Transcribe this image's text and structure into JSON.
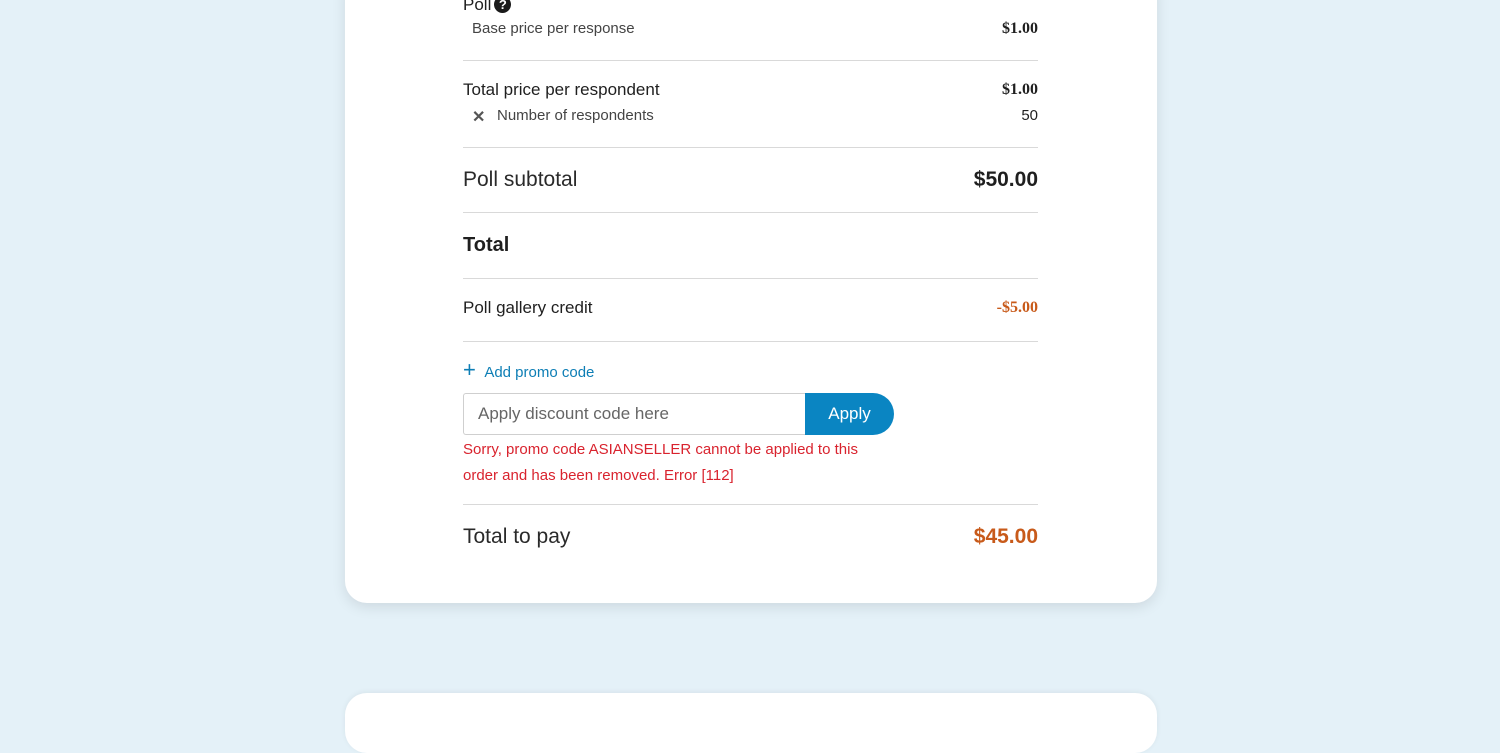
{
  "poll": {
    "title": "Poll",
    "help_icon": "?",
    "base_price_label": "Base price per response",
    "base_price_value": "$1.00"
  },
  "respondent": {
    "total_price_label": "Total price per respondent",
    "total_price_value": "$1.00",
    "multiply_icon": "✕",
    "count_label": "Number of respondents",
    "count_value": "50"
  },
  "subtotal": {
    "label": "Poll subtotal",
    "value": "$50.00"
  },
  "total": {
    "heading": "Total",
    "credit_label": "Poll gallery credit",
    "credit_value": "-$5.00"
  },
  "promo": {
    "add_icon": "+",
    "add_label": "Add promo code",
    "input_placeholder": "Apply discount code here",
    "input_value": "",
    "apply_label": "Apply",
    "error_text": "Sorry, promo code ASIANSELLER cannot be applied to this order and has been removed. Error [112]"
  },
  "pay": {
    "label": "Total to pay",
    "value": "$45.00"
  },
  "colors": {
    "background": "#e4f1f8",
    "accent": "#0a85c2",
    "link": "#0d7eb5",
    "price_highlight": "#c85a1a",
    "error": "#d9232e"
  }
}
